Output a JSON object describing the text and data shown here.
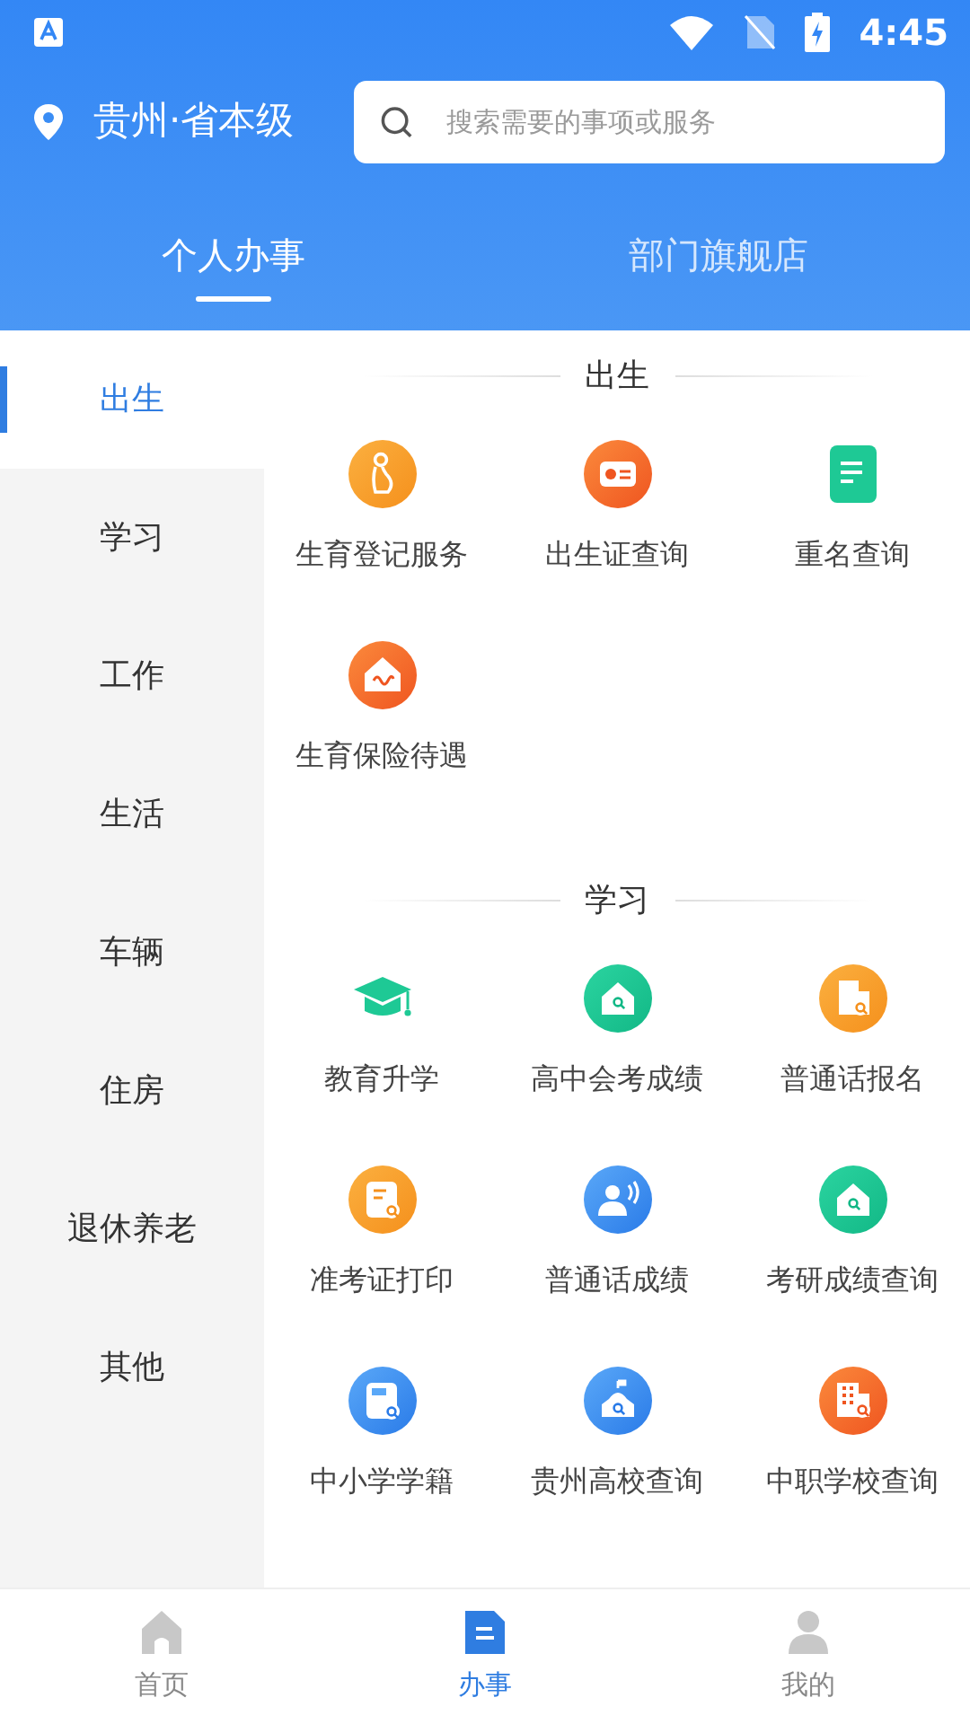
{
  "status_bar": {
    "time": "4:45"
  },
  "location": {
    "label": "贵州·省本级"
  },
  "search": {
    "placeholder": "搜索需要的事项或服务"
  },
  "tabs": [
    {
      "label": "个人办事",
      "selected": true
    },
    {
      "label": "部门旗舰店",
      "selected": false
    }
  ],
  "sidebar": {
    "items": [
      {
        "label": "出生",
        "selected": true
      },
      {
        "label": "学习",
        "selected": false
      },
      {
        "label": "工作",
        "selected": false
      },
      {
        "label": "生活",
        "selected": false
      },
      {
        "label": "车辆",
        "selected": false
      },
      {
        "label": "住房",
        "selected": false
      },
      {
        "label": "退休养老",
        "selected": false
      },
      {
        "label": "其他",
        "selected": false
      }
    ]
  },
  "sections": [
    {
      "title": "出生",
      "items": [
        {
          "label": "生育登记服务"
        },
        {
          "label": "出生证查询"
        },
        {
          "label": "重名查询"
        },
        {
          "label": "生育保险待遇"
        }
      ]
    },
    {
      "title": "学习",
      "items": [
        {
          "label": "教育升学"
        },
        {
          "label": "高中会考成绩"
        },
        {
          "label": "普通话报名"
        },
        {
          "label": "准考证打印"
        },
        {
          "label": "普通话成绩"
        },
        {
          "label": "考研成绩查询"
        },
        {
          "label": "中小学学籍"
        },
        {
          "label": "贵州高校查询"
        },
        {
          "label": "中职学校查询"
        }
      ]
    }
  ],
  "bottom_nav": [
    {
      "label": "首页",
      "selected": false
    },
    {
      "label": "办事",
      "selected": true
    },
    {
      "label": "我的",
      "selected": false
    }
  ]
}
